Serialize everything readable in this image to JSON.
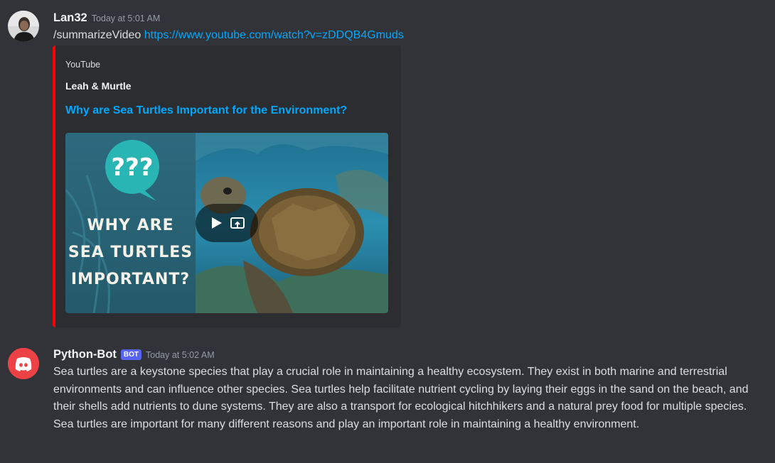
{
  "messages": [
    {
      "username": "Lan32",
      "timestamp": "Today at 5:01 AM",
      "command": "/summarizeVideo",
      "link": "https://www.youtube.com/watch?v=zDDQB4Gmuds",
      "embed": {
        "provider": "YouTube",
        "author": "Leah & Murtle",
        "title": "Why are Sea Turtles Important for the Environment?",
        "accent_color": "#ff0000",
        "thumbnail": {
          "bubble_text": "???",
          "line1": "WHY ARE",
          "line2": "SEA TURTLES",
          "line3": "IMPORTANT?"
        }
      }
    },
    {
      "username": "Python-Bot",
      "bot_tag": "BOT",
      "timestamp": "Today at 5:02 AM",
      "text": "Sea turtles are a keystone species that play a crucial role in maintaining a healthy ecosystem. They exist in both marine and terrestrial environments and can influence other species. Sea turtles help facilitate nutrient cycling by laying their eggs in the sand on the beach, and their shells add nutrients to dune systems. They are also a transport for ecological hitchhikers and a natural prey food for multiple species. Sea turtles are important for many different reasons and play an important role in maintaining a healthy environment."
    }
  ],
  "colors": {
    "background": "#313338",
    "embed_bg": "#2b2d31",
    "link": "#00a8fc",
    "bot_tag": "#5865f2",
    "discord_avatar": "#ed4245"
  },
  "icons": {
    "play": "play-icon",
    "watch_later": "picture-in-picture-icon",
    "bot_avatar": "discord-logo-icon"
  }
}
